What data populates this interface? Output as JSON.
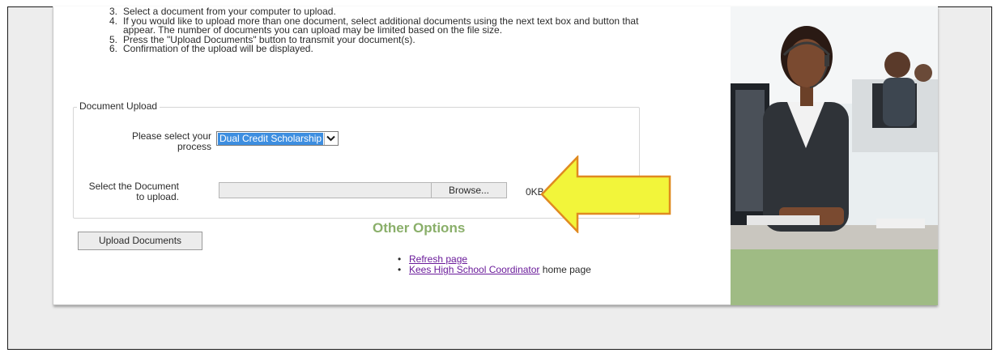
{
  "instructions": {
    "steps": [
      {
        "num": "3.",
        "text": "Select a document from your computer to upload."
      },
      {
        "num": "4.",
        "text": "If you would like to upload more than one document, select additional documents using the next text box and button that appear. The number of documents you can upload may be limited based on the file size."
      },
      {
        "num": "5.",
        "text": "Press the \"Upload Documents\" button to transmit your document(s)."
      },
      {
        "num": "6.",
        "text": "Confirmation of the upload will be displayed."
      }
    ]
  },
  "upload_form": {
    "legend": "Document Upload",
    "process_label": "Please select your process",
    "process_selected": "Dual Credit Scholarship",
    "document_label": "Select the Document to upload.",
    "file_value": "",
    "browse_label": "Browse...",
    "file_size": "0KB",
    "upload_button": "Upload Documents"
  },
  "other_options": {
    "title": "Other Options",
    "links": [
      {
        "link_text": "Refresh page",
        "suffix": ""
      },
      {
        "link_text": "Kees High School Coordinator",
        "suffix": " home page"
      }
    ]
  },
  "colors": {
    "options_title": "#8aaf6a",
    "link": "#6a1b9a",
    "selection": "#3d8ee0",
    "arrow_fill": "#f2f53a",
    "arrow_outline": "#e08a20",
    "sidebar": "#9fbb84"
  },
  "icons": {
    "dropdown": "chevron-down-icon",
    "annotation": "arrow-left-icon"
  }
}
